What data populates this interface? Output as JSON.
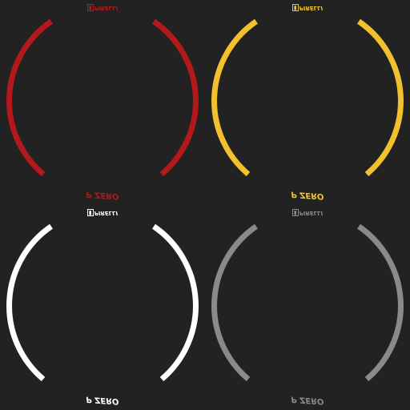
{
  "variants": [
    {
      "color_name": "red",
      "color": "#b3191b",
      "brand_top": "PIRELLI",
      "brand_bottom": "P ZERO"
    },
    {
      "color_name": "yellow",
      "color": "#f2c12e",
      "brand_top": "PIRELLI",
      "brand_bottom": "P ZERO"
    },
    {
      "color_name": "white",
      "color": "#ffffff",
      "brand_top": "PIRELLI",
      "brand_bottom": "P ZERO"
    },
    {
      "color_name": "grey",
      "color": "#8a8a8a",
      "brand_top": "PIRELLI",
      "brand_bottom": "P ZERO"
    }
  ]
}
